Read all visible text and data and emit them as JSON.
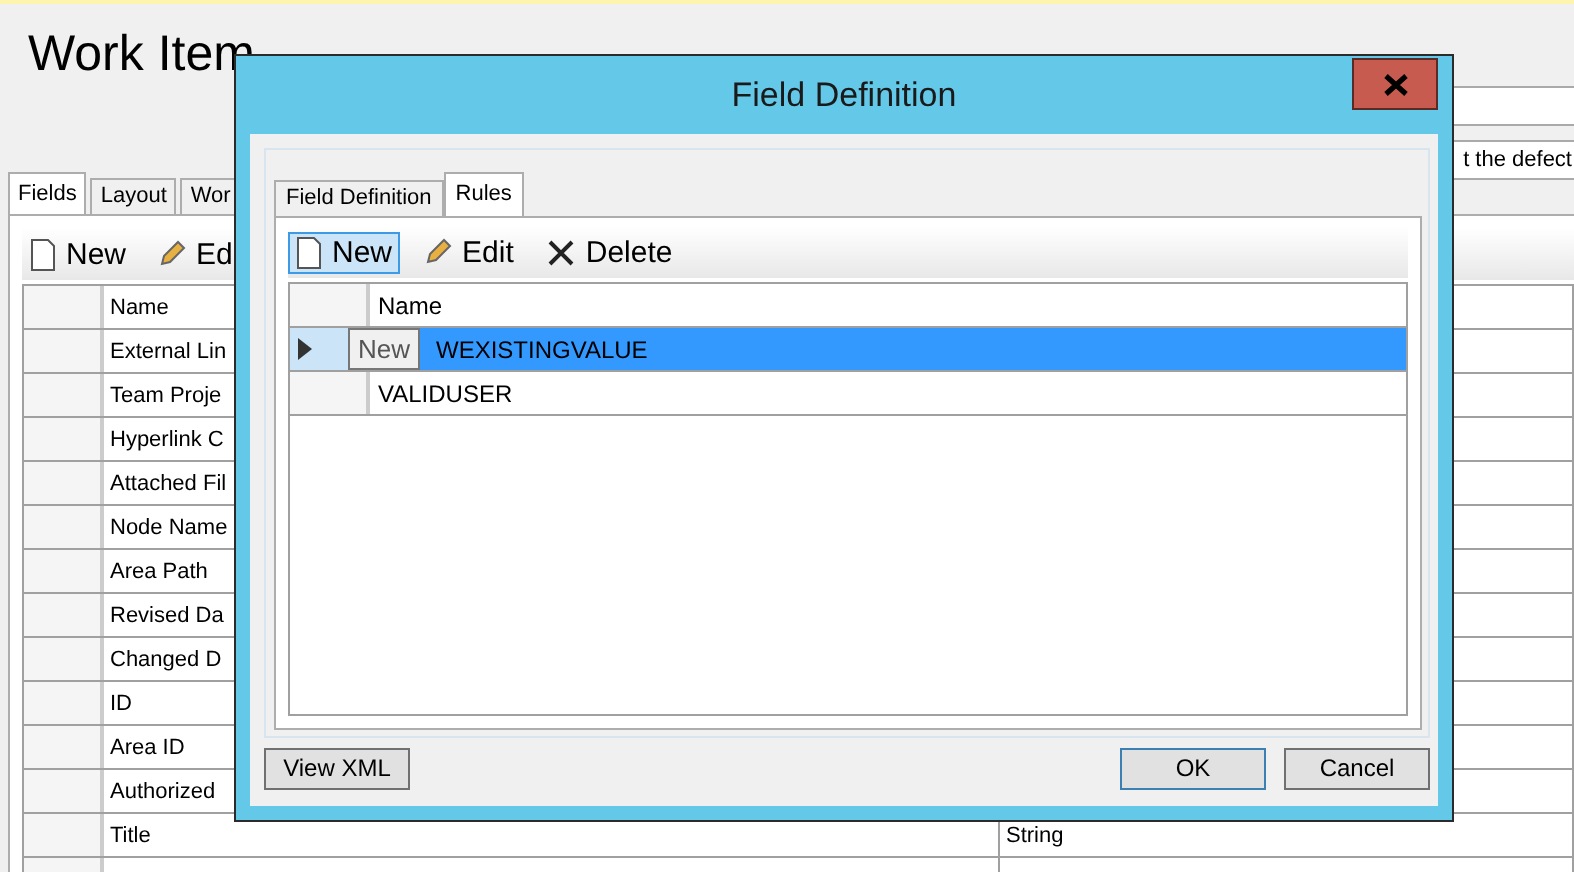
{
  "window": {
    "title": "Work Item"
  },
  "description_field": {
    "value": "t the defect"
  },
  "tabs": [
    {
      "label": "Fields",
      "selected": true
    },
    {
      "label": "Layout",
      "selected": false
    },
    {
      "label": "Wor",
      "selected": false
    }
  ],
  "toolbar": [
    {
      "label": "New",
      "kind": "new"
    },
    {
      "label": "Ed",
      "kind": "edit"
    }
  ],
  "fields_table": {
    "columns": [
      "Name"
    ],
    "rows": [
      {
        "name": "External Lin"
      },
      {
        "name": "Team Proje"
      },
      {
        "name": "Hyperlink C"
      },
      {
        "name": "Attached Fil"
      },
      {
        "name": "Node Name"
      },
      {
        "name": "Area Path"
      },
      {
        "name": "Revised Da"
      },
      {
        "name": "Changed D"
      },
      {
        "name": "ID"
      },
      {
        "name": "Area ID"
      },
      {
        "name": "Authorized"
      },
      {
        "name": "Title",
        "type": "String"
      }
    ]
  },
  "dialog": {
    "title": "Field Definition",
    "tabs": [
      {
        "label": "Field Definition",
        "selected": false
      },
      {
        "label": "Rules",
        "selected": true
      }
    ],
    "toolbar": [
      {
        "label": "New",
        "kind": "new",
        "selected": true
      },
      {
        "label": "Edit",
        "kind": "edit",
        "selected": false
      },
      {
        "label": "Delete",
        "kind": "delete",
        "selected": false
      }
    ],
    "tooltip": "New",
    "rules_table": {
      "columns": [
        "Name"
      ],
      "rows": [
        {
          "name": "WEXISTINGVALUE",
          "selected": true
        },
        {
          "name": "VALIDUSER",
          "selected": false
        }
      ]
    },
    "buttons": [
      {
        "label": "View XML",
        "kind": "left"
      },
      {
        "label": "OK",
        "kind": "default"
      },
      {
        "label": "Cancel",
        "kind": "normal"
      }
    ]
  }
}
